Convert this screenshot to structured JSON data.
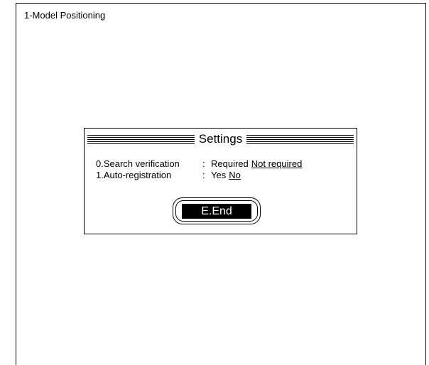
{
  "screen": {
    "title": "1-Model Positioning"
  },
  "dialog": {
    "title": "Settings",
    "rows": [
      {
        "label": "0.Search verification",
        "separator": ":",
        "options": [
          "Required",
          "Not required"
        ],
        "selected": "Not required"
      },
      {
        "label": "1.Auto-registration",
        "separator": ":",
        "options": [
          "Yes",
          "No"
        ],
        "selected": "No"
      }
    ],
    "end_button": "E.End"
  }
}
